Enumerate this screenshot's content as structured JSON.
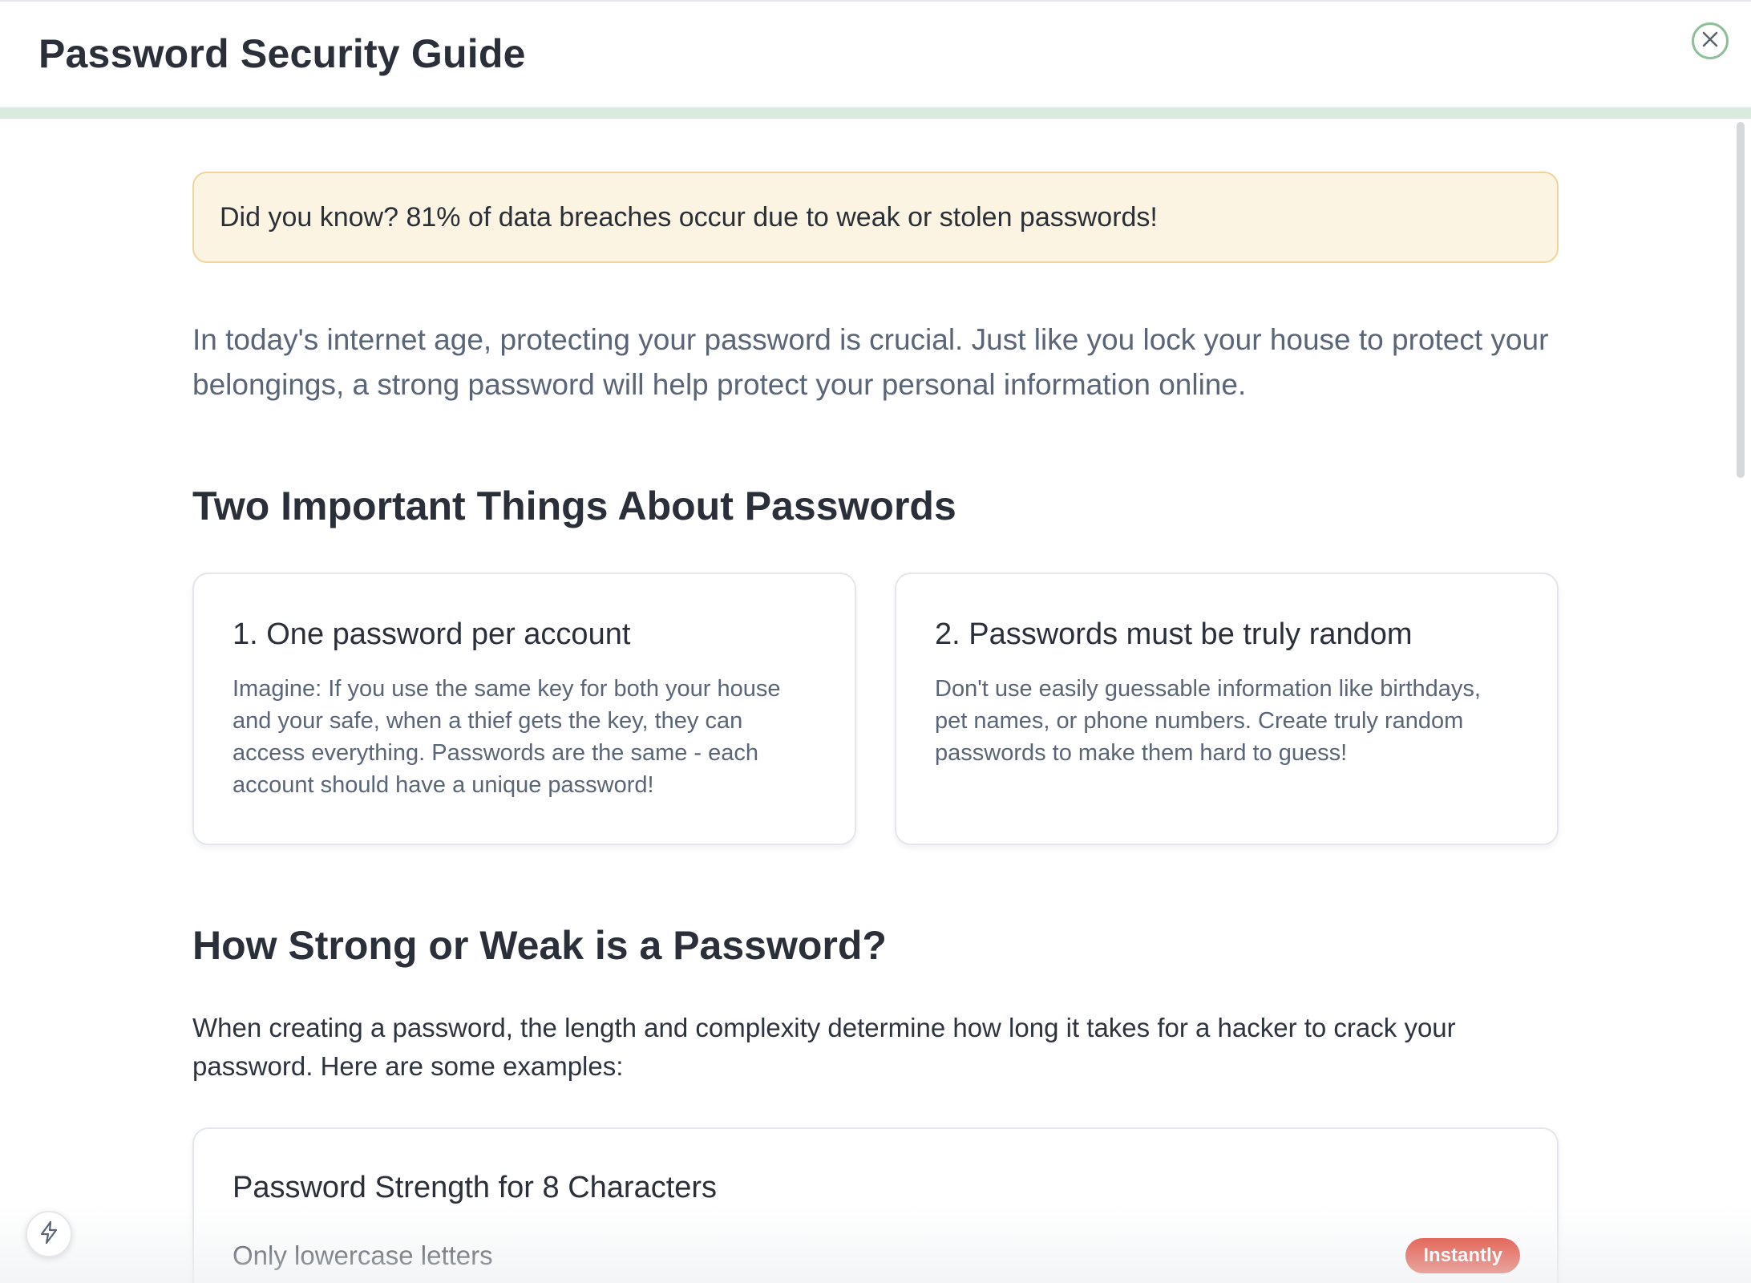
{
  "header": {
    "title": "Password Security Guide"
  },
  "progress": {
    "percent": 100,
    "color": "#d9ebdf"
  },
  "callout": {
    "text": "Did you know? 81% of data breaches occur due to weak or stolen passwords!"
  },
  "intro": "In today's internet age, protecting your password is crucial. Just like you lock your house to protect your belongings, a strong password will help protect your personal information online.",
  "things_section": {
    "heading": "Two Important Things About Passwords",
    "cards": [
      {
        "title": "1. One password per account",
        "text": "Imagine: If you use the same key for both your house and your safe, when a thief gets the key, they can access everything. Passwords are the same - each account should have a unique password!"
      },
      {
        "title": "2. Passwords must be truly random",
        "text": "Don't use easily guessable information like birthdays, pet names, or phone numbers. Create truly random passwords to make them hard to guess!"
      }
    ]
  },
  "strength_section": {
    "heading": "How Strong or Weak is a Password?",
    "description": "When creating a password, the length and complexity determine how long it takes for a hacker to crack your password. Here are some examples:",
    "card": {
      "title": "Password Strength for 8 Characters",
      "rows": [
        {
          "label": "Only lowercase letters",
          "badge": "Instantly",
          "badge_color": "#e0301e"
        }
      ]
    }
  },
  "icons": {
    "close": "close-icon",
    "bolt": "bolt-icon"
  },
  "colors": {
    "accent_green": "#8fbf9a",
    "callout_bg": "#fcf4e3",
    "callout_border": "#f1d596",
    "danger": "#e0301e"
  }
}
